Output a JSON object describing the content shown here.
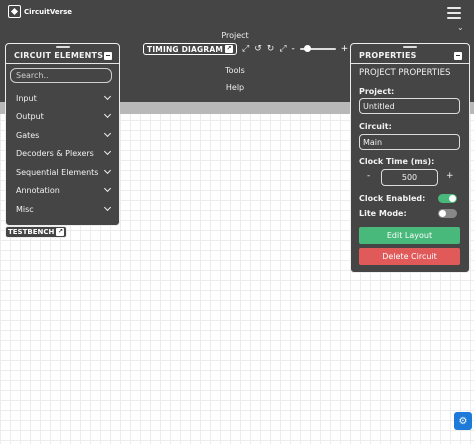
{
  "colors": {
    "navbar": "#454545",
    "panel_bg": "#454545",
    "ribbon": "#b8b8b8",
    "grid_line": "#ececec",
    "edit_layout_green": "#48b87b",
    "delete_circuit_red": "#e05a5a",
    "toggle_on": "#48b87b",
    "toggle_off": "#888888",
    "report_button_blue": "#1e7ad8"
  },
  "navbar": {
    "brand": "CircuitVerse",
    "brand_icon": "circuitverse-logo-icon",
    "menu_icon": "hamburger-icon",
    "collapse_icon": "chevron-down-icon",
    "menu": [
      "Project",
      "Tools",
      "Help"
    ]
  },
  "timing_toolbar": {
    "label": "TIMING DIAGRAM",
    "icons": [
      "expand-icon",
      "contract-icon",
      "undo-icon",
      "redo-icon",
      "fit-icon"
    ],
    "zoom_minus": "-",
    "zoom_plus": "+",
    "zoom_level": 0.15
  },
  "elements_panel": {
    "title": "CIRCUIT ELEMENTS",
    "search_placeholder": "Search..",
    "categories": [
      "Input",
      "Output",
      "Gates",
      "Decoders & Plexers",
      "Sequential Elements",
      "Annotation",
      "Misc"
    ]
  },
  "testbench": {
    "label": "TESTBENCH"
  },
  "properties_panel": {
    "title": "PROPERTIES",
    "section_title": "PROJECT PROPERTIES",
    "project_label": "Project:",
    "project_value": "Untitled",
    "circuit_label": "Circuit:",
    "circuit_value": "Main",
    "clock_time_label": "Clock Time (ms):",
    "clock_decrement": "-",
    "clock_value": "500",
    "clock_increment": "+",
    "clock_enabled_label": "Clock Enabled:",
    "clock_enabled": true,
    "lite_mode_label": "Lite Mode:",
    "lite_mode": false,
    "edit_layout_label": "Edit Layout",
    "delete_circuit_label": "Delete Circuit"
  },
  "report_button_icon": "bug-report-icon"
}
